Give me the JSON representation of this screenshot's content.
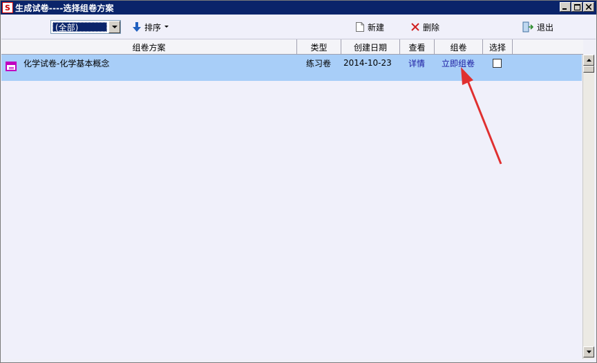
{
  "window": {
    "app_icon_letter": "S",
    "title": "生成试卷----选择组卷方案"
  },
  "toolbar": {
    "filter_value": "(全部)",
    "sort_label": "排序",
    "new_label": "新建",
    "delete_label": "删除",
    "exit_label": "退出"
  },
  "grid": {
    "columns": [
      "组卷方案",
      "类型",
      "创建日期",
      "查看",
      "组卷",
      "选择"
    ],
    "rows": [
      {
        "name": "化学试卷-化学基本概念",
        "type": "练习卷",
        "date": "2014-10-23",
        "view": "详情",
        "compose": "立即组卷",
        "selected": false
      }
    ]
  },
  "colors": {
    "title_bar": "#0a246a",
    "selected_row": "#a8cef8",
    "link": "#1a1aa0",
    "annotation_arrow": "#e03030"
  }
}
